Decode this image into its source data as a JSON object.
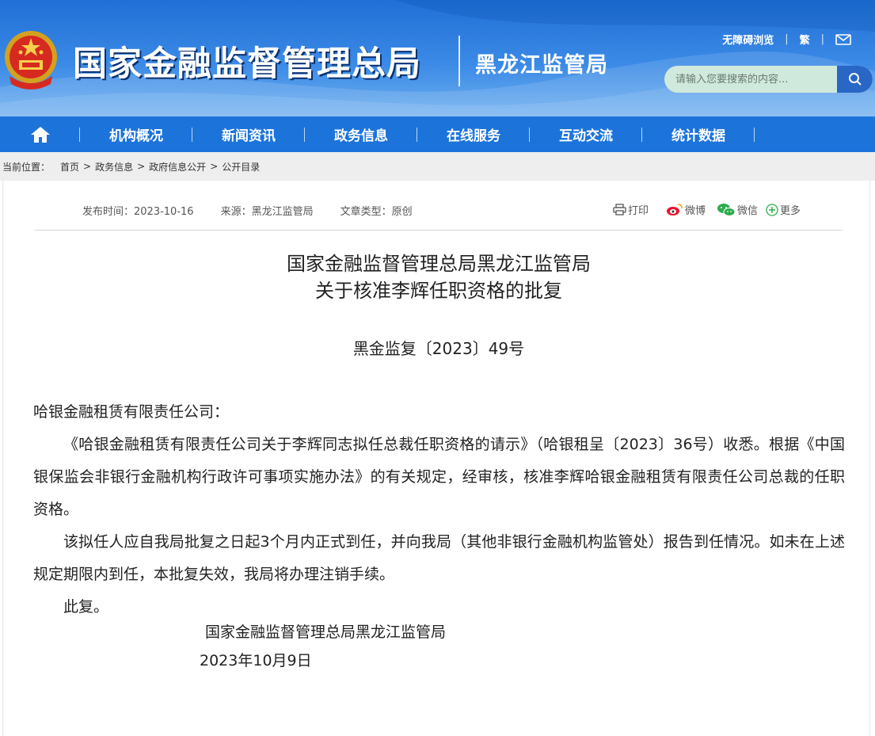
{
  "header": {
    "site_title": "国家金融监督管理总局",
    "sub_title": "黑龙江监管局",
    "accessibility_link": "无障碍浏览",
    "traditional_link": "繁",
    "search_placeholder": "请输入您要搜索的内容...",
    "icons": [
      "national-emblem",
      "mail-icon",
      "search-icon"
    ]
  },
  "nav": {
    "home_icon": "home-icon",
    "items": [
      {
        "label": "机构概况"
      },
      {
        "label": "新闻资讯"
      },
      {
        "label": "政务信息"
      },
      {
        "label": "在线服务"
      },
      {
        "label": "互动交流"
      },
      {
        "label": "统计数据"
      }
    ]
  },
  "breadcrumb": {
    "prefix": "当前位置：",
    "items": [
      "首页",
      "政务信息",
      "政府信息公开",
      "公开目录"
    ],
    "separator": ">"
  },
  "article": {
    "publish_time": "发布时间：2023-10-16",
    "source": "来源：黑龙江监管局",
    "type": "文章类型：原创",
    "share": {
      "print": "打印",
      "weibo": "微博",
      "wechat": "微信",
      "more": "更多"
    },
    "title_line1": "国家金融监督管理总局黑龙江监管局",
    "title_line2": "关于核准李辉任职资格的批复",
    "doc_number": "黑金监复〔2023〕49号",
    "salutation": "哈银金融租赁有限责任公司：",
    "paragraph1": "《哈银金融租赁有限责任公司关于李辉同志拟任总裁任职资格的请示》（哈银租呈〔2023〕36号）收悉。根据《中国银保监会非银行金融机构行政许可事项实施办法》的有关规定，经审核，核准李辉哈银金融租赁有限责任公司总裁的任职资格。",
    "paragraph2": "该拟任人应自我局批复之日起3个月内正式到任，并向我局（其他非银行金融机构监管处）报告到任情况。如未在上述规定期限内到任，本批复失效，我局将办理注销手续。",
    "closing": "此复。",
    "signature": "国家金融监督管理总局黑龙江监管局",
    "date": "2023年10月9日"
  },
  "colors": {
    "header_blue": "#1f6fd6",
    "nav_blue": "#1c74db",
    "search_bg": "#cfe9dc",
    "search_button": "#2867c6"
  }
}
